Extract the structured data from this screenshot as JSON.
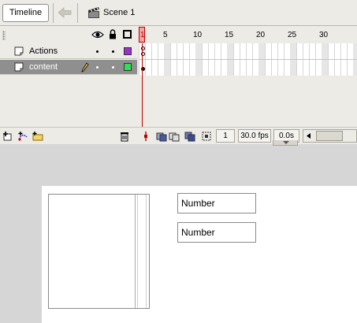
{
  "scene_bar": {
    "timeline_button": "Timeline",
    "scene_name": "Scene 1",
    "back_icon": "left-arrow-icon",
    "scene_icon": "clapperboard-icon"
  },
  "layer_header": {
    "icons": [
      "eye-icon",
      "lock-icon",
      "outline-icon"
    ]
  },
  "layers": [
    {
      "name": "Actions",
      "color": "#9932cc",
      "selected": false
    },
    {
      "name": "content",
      "color": "#33dd55",
      "selected": true
    }
  ],
  "frame_ruler": {
    "current_frame": "1",
    "labels": [
      "5",
      "10",
      "15",
      "20",
      "25",
      "30"
    ]
  },
  "toolbar": {
    "current_frame": "1",
    "frame_rate": "30.0 fps",
    "elapsed": "0.0s",
    "icons": [
      "insert-layer-icon",
      "add-motion-guide-icon",
      "insert-folder-icon",
      "delete-layer-icon",
      "center-frame-icon",
      "onion-skin-icon",
      "onion-skin-outlines-icon",
      "edit-multiple-frames-icon",
      "modify-onion-markers-icon"
    ]
  },
  "stage": {
    "fields": [
      {
        "value": "Number"
      },
      {
        "value": "Number"
      }
    ]
  }
}
